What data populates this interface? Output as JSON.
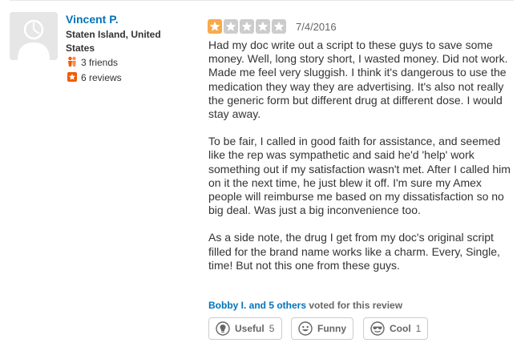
{
  "reviewer": {
    "name": "Vincent P.",
    "location": "Staten Island, United States",
    "friends_text": "3 friends",
    "reviews_text": "6 reviews"
  },
  "review": {
    "rating": 1,
    "max_rating": 5,
    "date": "7/4/2016",
    "paragraphs": [
      "Had my doc write out a script to these guys to save some money. Well, long story short, I wasted money. Did not work. Made me feel very sluggish. I think it's dangerous to use the medication they way they are advertising. It's also not really the generic form but different drug at different dose. I would stay away.",
      "To be fair, I called in good faith for assistance, and seemed like the rep was sympathetic and said he'd 'help' work something out if my satisfaction wasn't met. After I called him on it the next time, he just blew it off.  I'm sure my Amex people will reimburse me based on my dissatisfaction so no big deal. Was just a big inconvenience too.",
      "As a side note, the drug I get from my doc's original script filled for the brand name works like a charm. Every, Single, time! But not this one from these guys."
    ]
  },
  "votes": {
    "voters_link": "Bobby I. and 5 others",
    "voters_suffix": "voted for this review",
    "useful": {
      "label": "Useful",
      "count": "5"
    },
    "funny": {
      "label": "Funny",
      "count": ""
    },
    "cool": {
      "label": "Cool",
      "count": "1"
    }
  },
  "colors": {
    "link": "#0073bb",
    "star_filled": "#f8a94b",
    "star_empty": "#cccccc",
    "friends_icon": "#f15c00",
    "reviews_icon": "#f15c00"
  }
}
